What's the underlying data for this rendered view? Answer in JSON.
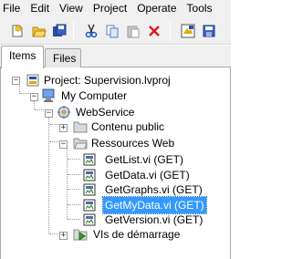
{
  "menu": [
    "File",
    "Edit",
    "View",
    "Project",
    "Operate",
    "Tools"
  ],
  "toolbar": {
    "icons": [
      "new-icon",
      "open-icon",
      "save-all-icon",
      "cut-icon",
      "copy-icon",
      "paste-icon",
      "delete-icon",
      "build-icon",
      "save-icon"
    ]
  },
  "tabs": {
    "items": "Items",
    "files": "Files"
  },
  "tree": {
    "project": "Project: Supervision.lvproj",
    "computer": "My Computer",
    "webservice": "WebService",
    "contenu": "Contenu public",
    "ressources": "Ressources Web",
    "vis": [
      "GetList.vi (GET)",
      "GetData.vi (GET)",
      "GetGraphs.vi (GET)",
      "GetMyData.vi (GET)",
      "GetVersion.vi (GET)"
    ],
    "startup": "VIs de démarrage",
    "selected": "GetMyData.vi (GET)"
  }
}
